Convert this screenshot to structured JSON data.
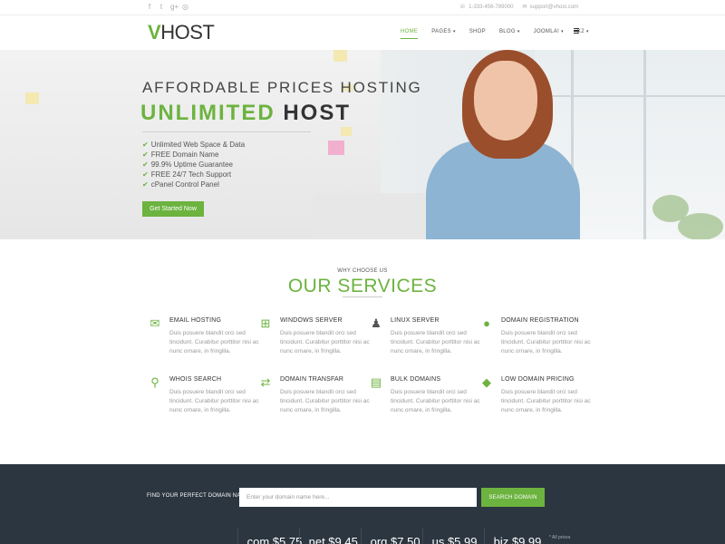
{
  "topbar": {
    "social": [
      "f",
      "t",
      "g+",
      "◎"
    ],
    "phone": "1-333-456-789000",
    "email": "support@vhost.com"
  },
  "header": {
    "logo_accent": "V",
    "logo_rest": "HOST",
    "nav": [
      {
        "label": "HOME",
        "caret": false,
        "active": true
      },
      {
        "label": "PAGES",
        "caret": true,
        "active": false
      },
      {
        "label": "SHOP",
        "caret": false,
        "active": false
      },
      {
        "label": "BLOG",
        "caret": true,
        "active": false
      },
      {
        "label": "JOOMLA!",
        "caret": true,
        "active": false
      },
      {
        "label": "K2",
        "caret": true,
        "active": false
      }
    ]
  },
  "hero": {
    "subtitle": "AFFORDABLE PRICES HOSTING",
    "title_accent": "UNLIMITED",
    "title_rest": "HOST",
    "features": [
      "Unlimited Web Space & Data",
      "FREE Domain Name",
      "99.9% Uptime Guarantee",
      "FREE 24/7 Tech Support",
      "cPanel Control Panel"
    ],
    "cta_label": "Get Started Now"
  },
  "services": {
    "eyebrow": "WHY CHOOSE US",
    "title": "OUR SERVICES",
    "items": [
      {
        "title": "EMAIL HOSTING",
        "icon": "envelope-icon",
        "desc": "Duis posuere blandit orci sed tincidunt. Curabitur porttitor nisi ac nunc ornare, in fringilla."
      },
      {
        "title": "WINDOWS SERVER",
        "icon": "windows-icon",
        "desc": "Duis posuere blandit orci sed tincidunt. Curabitur porttitor nisi ac nunc ornare, in fringilla."
      },
      {
        "title": "LINUX SERVER",
        "icon": "linux-icon",
        "desc": "Duis posuere blandit orci sed tincidunt. Curabitur porttitor nisi ac nunc ornare, in fringilla."
      },
      {
        "title": "DOMAIN REGISTRATION",
        "icon": "globe-icon",
        "desc": "Duis posuere blandit orci sed tincidunt. Curabitur porttitor nisi ac nunc ornare, in fringilla."
      },
      {
        "title": "WHOIS SEARCH",
        "icon": "search-icon",
        "desc": "Duis posuere blandit orci sed tincidunt. Curabitur porttitor nisi ac nunc ornare, in fringilla."
      },
      {
        "title": "DOMAIN TRANSFAR",
        "icon": "exchange-icon",
        "desc": "Duis posuere blandit orci sed tincidunt. Curabitur porttitor nisi ac nunc ornare, in fringilla."
      },
      {
        "title": "BULK DOMAINS",
        "icon": "basket-icon",
        "desc": "Duis posuere blandit orci sed tincidunt. Curabitur porttitor nisi ac nunc ornare, in fringilla."
      },
      {
        "title": "LOW DOMAIN PRICING",
        "icon": "tag-icon",
        "desc": "Duis posuere blandit orci sed tincidunt. Curabitur porttitor nisi ac nunc ornare, in fringilla."
      }
    ]
  },
  "domain_search": {
    "label": "FIND YOUR PERFECT DOMAIN NAME",
    "placeholder": "Enter your domain name here...",
    "button": "SEARCH DOMAIN",
    "tlds": [
      ".com $5.75",
      ".net $9.45",
      ".org $7.50",
      ".us $5.99",
      ".biz $9.99"
    ],
    "note": "* All prices"
  },
  "colors": {
    "accent": "#6cb33f",
    "dark": "#2b3640"
  }
}
